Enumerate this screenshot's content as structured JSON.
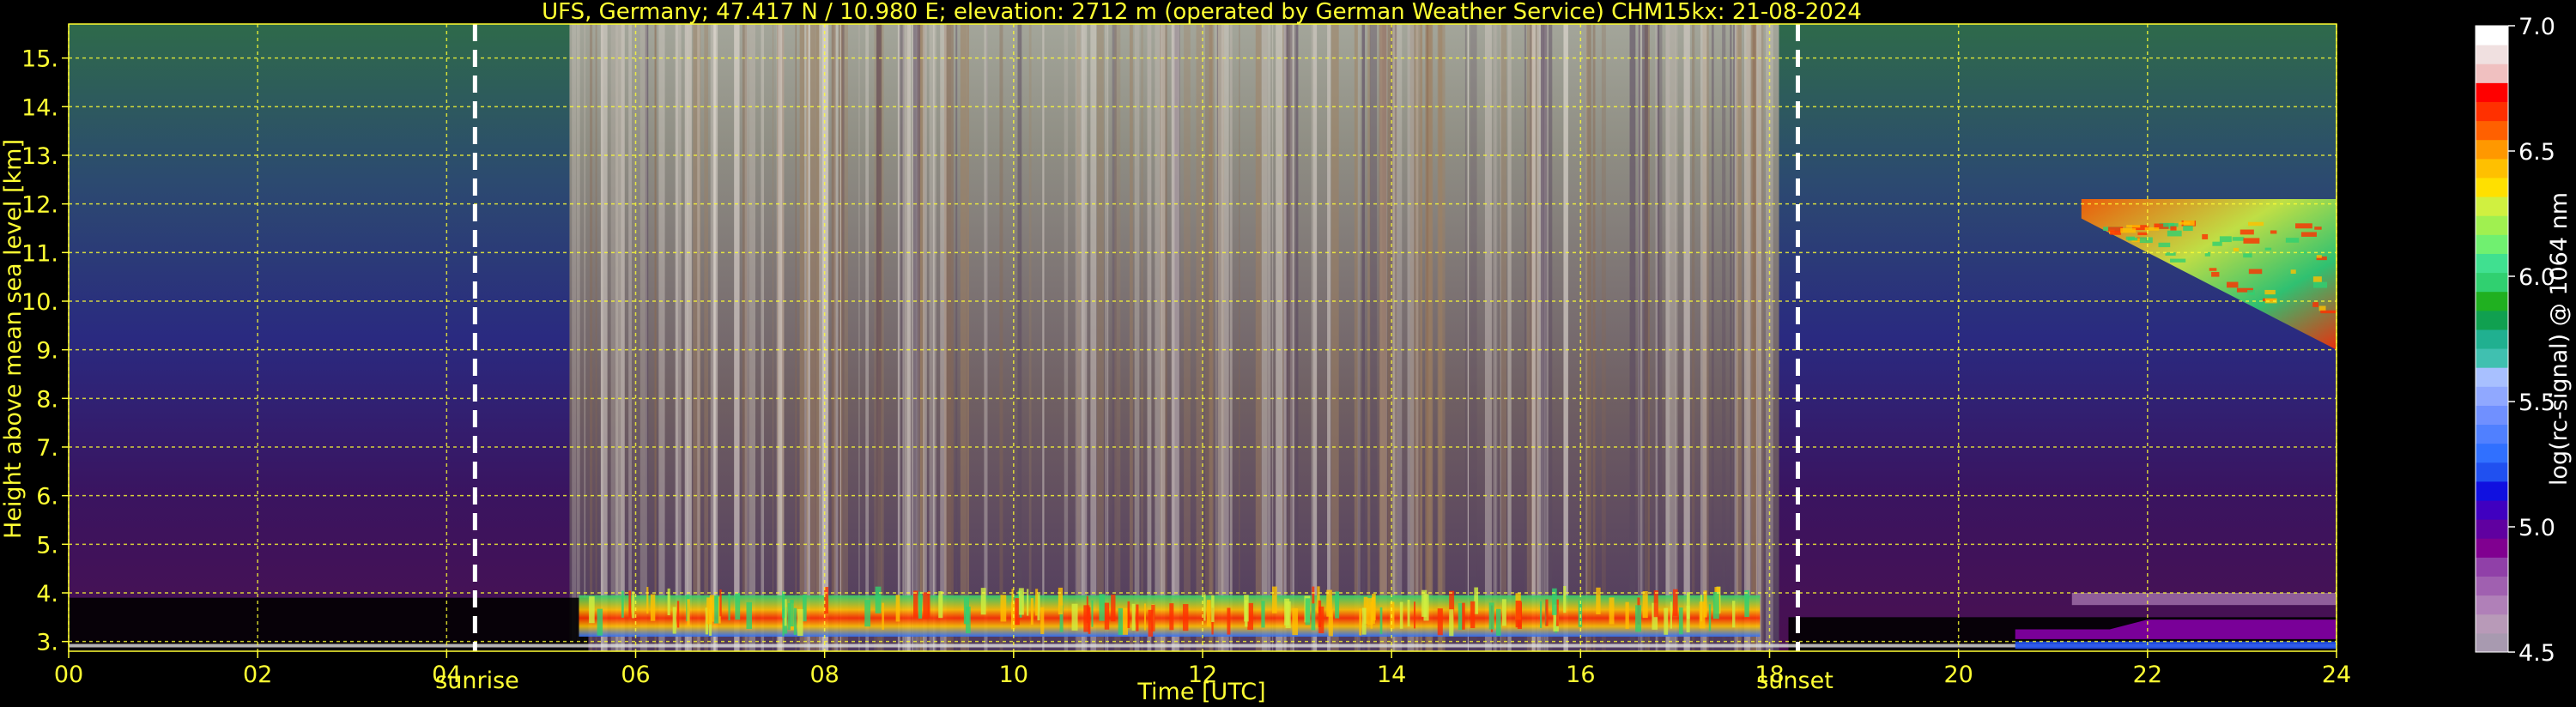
{
  "chart_data": {
    "type": "heatmap",
    "title": "UFS, Germany; 47.417 N / 10.980 E; elevation: 2712 m  (operated by German Weather Service)    CHM15kx: 21-08-2024",
    "xlabel": "Time [UTC]",
    "ylabel": "Height above mean sea level [km]",
    "xlim": [
      0,
      24
    ],
    "ylim": [
      2.8,
      15.7
    ],
    "x_ticks": [
      0,
      2,
      4,
      6,
      8,
      10,
      12,
      14,
      16,
      18,
      20,
      22,
      24
    ],
    "x_tick_labels": [
      "00",
      "02",
      "04",
      "06",
      "08",
      "10",
      "12",
      "14",
      "16",
      "18",
      "20",
      "22",
      "24"
    ],
    "y_ticks": [
      3,
      4,
      5,
      6,
      7,
      8,
      9,
      10,
      11,
      12,
      13,
      14,
      15
    ],
    "y_tick_labels": [
      "3.",
      "4.",
      "5.",
      "6.",
      "7.",
      "8.",
      "9.",
      "10.",
      "11.",
      "12.",
      "13.",
      "14.",
      "15."
    ],
    "grid": true,
    "annotations": [
      {
        "label": "sunrise",
        "x": 4.3
      },
      {
        "label": "sunset",
        "x": 18.3
      }
    ],
    "colorbar": {
      "label": "log(rc-signal) @ 1064 nm",
      "range": [
        4.5,
        7.0
      ],
      "ticks": [
        4.5,
        5.0,
        5.5,
        6.0,
        6.5,
        7.0
      ],
      "tick_labels": [
        "4.5",
        "5.0",
        "5.5",
        "6.0",
        "6.5",
        "7.0"
      ],
      "colors": [
        "#a89ab0",
        "#b89ab8",
        "#b080b8",
        "#a060b0",
        "#9040a8",
        "#800090",
        "#6000a0",
        "#4000c0",
        "#1010e0",
        "#2050f0",
        "#3070ff",
        "#5080ff",
        "#7090ff",
        "#90a8ff",
        "#a8c0ff",
        "#40c0b0",
        "#20b090",
        "#10a050",
        "#20b020",
        "#30d070",
        "#40e090",
        "#70f070",
        "#a0f050",
        "#d0f040",
        "#ffe000",
        "#ffc000",
        "#ff9800",
        "#ff6000",
        "#ff3000",
        "#ff0000",
        "#f0c0c0",
        "#f0e0e0",
        "#ffffff"
      ]
    }
  }
}
